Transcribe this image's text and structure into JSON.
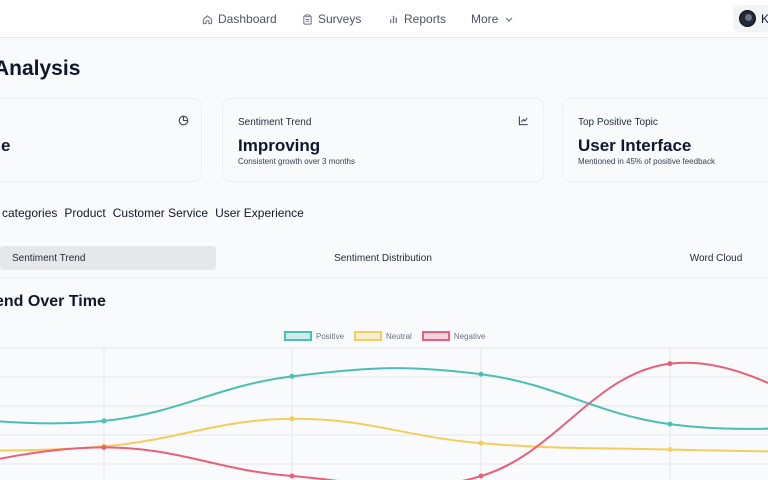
{
  "nav": {
    "items": [
      {
        "label": "Dashboard",
        "icon": "home-icon"
      },
      {
        "label": "Surveys",
        "icon": "clipboard-icon"
      },
      {
        "label": "Reports",
        "icon": "bar-chart-icon"
      },
      {
        "label": "More",
        "icon": "chevron-down-icon"
      }
    ],
    "user_initial": "K"
  },
  "page": {
    "title": "Analysis"
  },
  "cards": [
    {
      "title": "",
      "value": "e",
      "subtitle": "",
      "icon": "pie-chart-icon"
    },
    {
      "title": "Sentiment Trend",
      "value": "Improving",
      "subtitle": "Consistent growth over 3 months",
      "icon": "line-chart-icon"
    },
    {
      "title": "Top Positive Topic",
      "value": "User Interface",
      "subtitle": "Mentioned in 45% of positive feedback",
      "icon": ""
    }
  ],
  "filters": [
    "l categories",
    "Product",
    "Customer Service",
    "User Experience"
  ],
  "tabs": [
    "Sentiment Trend",
    "Sentiment Distribution",
    "Word Cloud"
  ],
  "chart_section": {
    "title": "end Over Time"
  },
  "colors": {
    "positive": "#4bbfb3",
    "neutral": "#f5cd5a",
    "negative": "#e8607a"
  },
  "chart_data": {
    "type": "line",
    "legend": "top-center",
    "grid": true,
    "series": [
      {
        "name": "Positive",
        "values": [
          0.24,
          0.18,
          0.6,
          0.62,
          0.15,
          0.14
        ]
      },
      {
        "name": "Neutral",
        "values": [
          -0.1,
          -0.06,
          0.2,
          -0.03,
          -0.09,
          -0.12
        ]
      },
      {
        "name": "Negative",
        "values": [
          -0.34,
          -0.07,
          -0.34,
          -0.34,
          0.72,
          0.1
        ]
      }
    ]
  }
}
